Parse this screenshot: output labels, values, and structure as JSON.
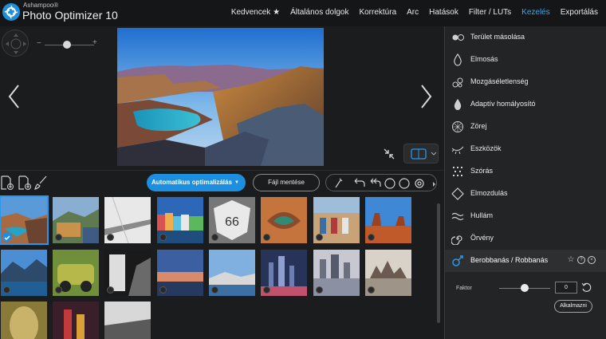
{
  "app": {
    "brand_small": "Ashampoo®",
    "title": "Photo Optimizer 10",
    "accent_color": "#1e8fe0"
  },
  "menu": {
    "items": [
      {
        "label": "Kedvencek ★"
      },
      {
        "label": "Általános dolgok"
      },
      {
        "label": "Korrektúra"
      },
      {
        "label": "Arc"
      },
      {
        "label": "Hatások"
      },
      {
        "label": "Filter / LUTs"
      },
      {
        "label": "Kezelés",
        "active": true
      },
      {
        "label": "Exportálás"
      }
    ]
  },
  "viewer": {
    "zoom_minus": "−",
    "zoom_plus": "+",
    "zoom_level": 0.45
  },
  "toolbar": {
    "auto_optimize_label": "Automatikus optimalizálás",
    "save_label": "Fájl mentése"
  },
  "panel": {
    "items": [
      {
        "label": "Terület másolása",
        "icon": "clone-icon"
      },
      {
        "label": "Elmosás",
        "icon": "drop-icon"
      },
      {
        "label": "Mozgáséletlenség",
        "icon": "motion-blur-icon"
      },
      {
        "label": "Adaptív homályosító",
        "icon": "adaptive-blur-icon"
      },
      {
        "label": "Zörej",
        "icon": "noise-icon"
      },
      {
        "label": "Eszközök",
        "icon": "tools-icon"
      },
      {
        "label": "Szórás",
        "icon": "scatter-icon"
      },
      {
        "label": "Elmozdulás",
        "icon": "displace-icon"
      },
      {
        "label": "Hullám",
        "icon": "wave-icon"
      },
      {
        "label": "Örvény",
        "icon": "swirl-icon"
      },
      {
        "label": "Berobbanás / Robbanás",
        "icon": "explode-icon",
        "active": true
      }
    ],
    "factor_label": "Faktor",
    "factor_value": "0",
    "factor_level": 0.5,
    "apply_label": "Alkalmazni"
  }
}
